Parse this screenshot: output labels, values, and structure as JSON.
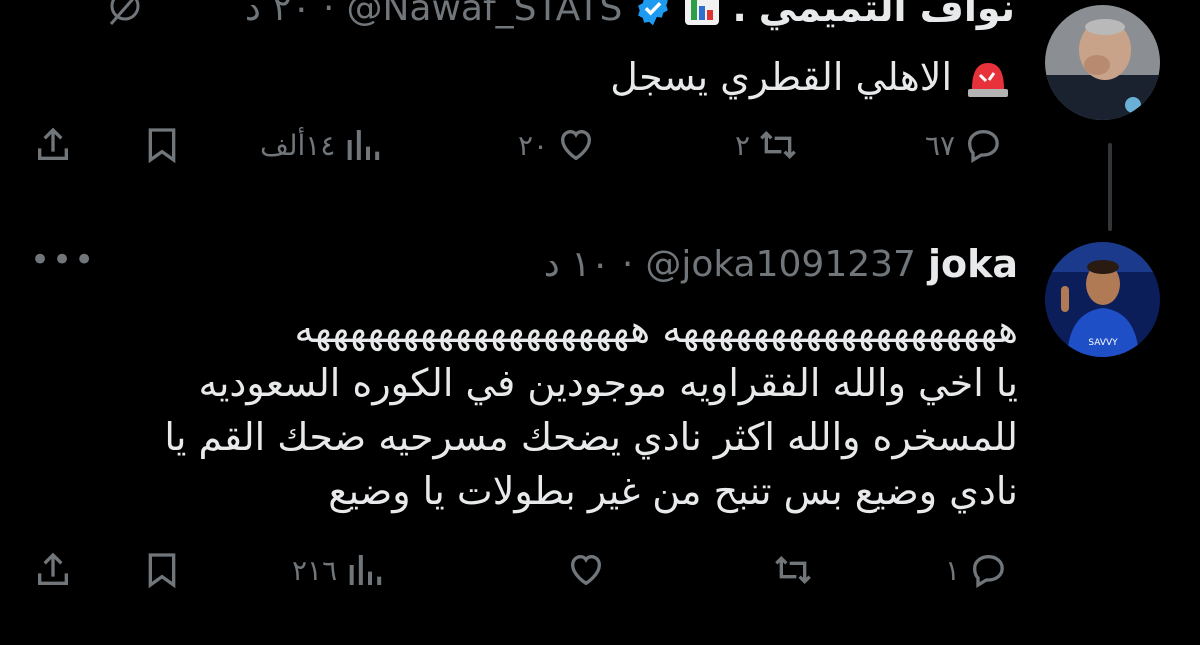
{
  "tweets": [
    {
      "author_name": "نواف التميمي",
      "author_suffix": ".",
      "handle": "@Nawaf_STATS",
      "time": "٢٠ د",
      "text": "الاهلي القطري يسجل",
      "stats": {
        "replies": "٦٧",
        "retweets": "٢",
        "likes": "٢٠",
        "views": "١٤ألف"
      },
      "icons": [
        "siren-emoji",
        "chart-emoji",
        "verified-badge-icon"
      ]
    },
    {
      "author_name": "joka",
      "handle": "@joka1091237",
      "time": "١٠ د",
      "text_lines": [
        "هههههههههههههههههههه هههههههههههههههههههه",
        "يا اخي والله الفقراويه موجودين في الكوره السعوديه",
        "للمسخره والله اكثر نادي يضحك مسرحيه ضحك القم يا",
        "نادي وضيع بس تنبح من غير بطولات يا وضيع"
      ],
      "stats": {
        "replies": "١",
        "retweets": "",
        "likes": "",
        "views": "٢١٦"
      }
    }
  ],
  "accent": "#1d9bf0",
  "muted": "#71767b"
}
